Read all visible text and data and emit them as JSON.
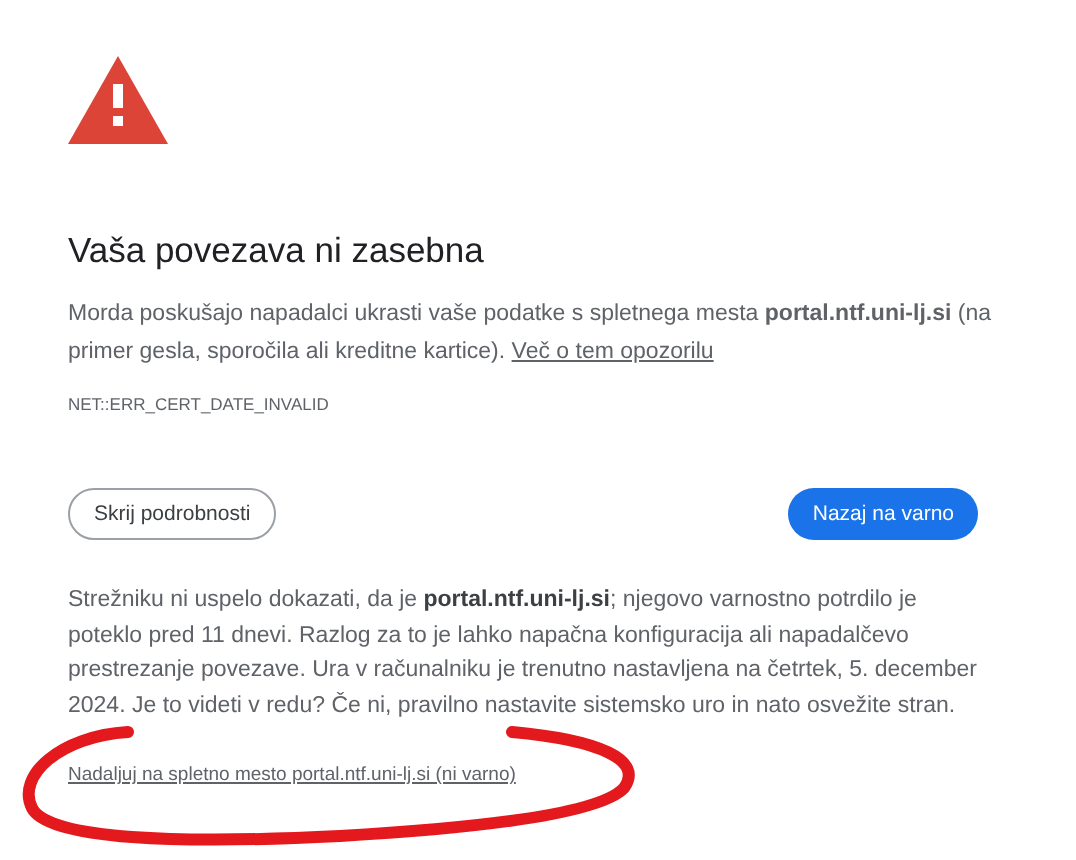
{
  "heading": "Vaša povezava ni zasebna",
  "intro": {
    "text": "Morda poskušajo napadalci ukrasti vaše podatke s spletnega mesta **portal.ntf.uni-lj.si** (na primer gesla, sporočila ali kreditne kartice).",
    "link": "Več o tem opozorilu"
  },
  "error_code": "NET::ERR_CERT_DATE_INVALID",
  "buttons": [
    {
      "label": "Skrij podrobnosti",
      "kind": "secondary"
    },
    {
      "label": "Nazaj na varno",
      "kind": "primary"
    }
  ],
  "details": "Strežniku ni uspelo dokazati, da je **portal.ntf.uni-lj.si**; njegovo varnostno potrdilo je poteklo pred 11 dnevi. Razlog za to je lahko napačna konfiguracija ali napadalčevo prestrezanje povezave. Ura v računalniku je trenutno nastavljena na četrtek, 5. december 2024. Je to videti v redu? Če ni, pravilno nastavite sistemsko uro in nato osvežite stran.",
  "proceed_link": "Nadaljuj na spletno mesto portal.ntf.uni-lj.si (ni varno)"
}
